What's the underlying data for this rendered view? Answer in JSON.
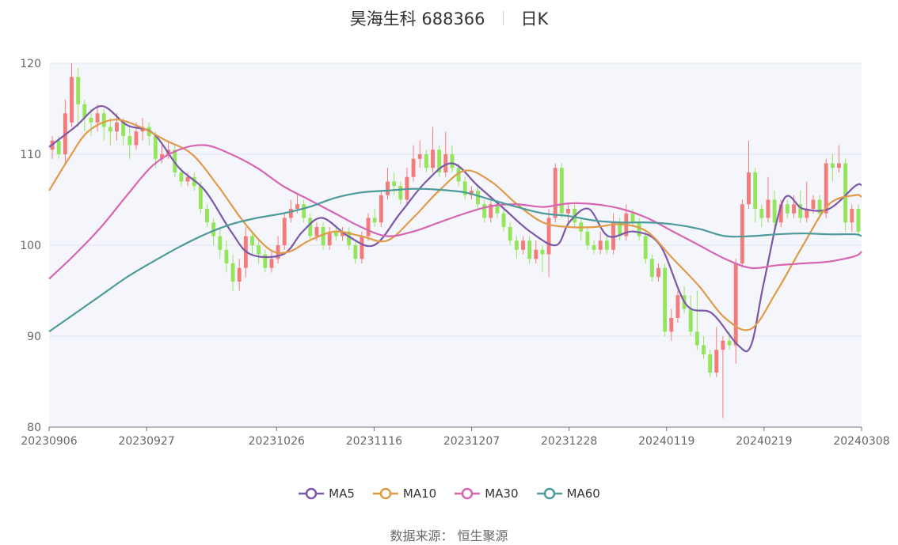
{
  "title": "昊海生科 688366",
  "subtitle": "日K",
  "source_label": "数据来源：",
  "source_value": "恒生聚源",
  "colors": {
    "up": "#f47b7b",
    "down": "#93e65b",
    "ma5": "#7b58a8",
    "ma10": "#e09b4a",
    "ma30": "#d865b0",
    "ma60": "#4d9a9a",
    "plot_bg": "#f5f6fb",
    "grid": "#dfe3f0"
  },
  "chart_data": {
    "type": "candlestick",
    "y_range": [
      80,
      120
    ],
    "y_ticks": [
      "120",
      "110",
      "100",
      "90",
      "80"
    ],
    "y_tick_values": [
      120,
      110,
      100,
      90,
      80
    ],
    "x_ticks": [
      "20230906",
      "20230927",
      "20231026",
      "20231116",
      "20231207",
      "20231228",
      "20240119",
      "20240219",
      "20240308"
    ],
    "x_tick_index": [
      0,
      15,
      35,
      50,
      65,
      80,
      95,
      110,
      125
    ],
    "n_days": 126,
    "candles": [
      [
        110.5,
        111.5,
        112.0,
        109.5
      ],
      [
        111.5,
        110.0,
        112.0,
        109.5
      ],
      [
        110.0,
        114.5,
        116.0,
        109.0
      ],
      [
        113.5,
        118.5,
        120.0,
        113.0
      ],
      [
        118.5,
        115.5,
        119.5,
        113.0
      ],
      [
        115.5,
        114.0,
        116.0,
        112.5
      ],
      [
        114.0,
        113.5,
        115.0,
        112.0
      ],
      [
        113.5,
        114.5,
        115.5,
        112.5
      ],
      [
        114.5,
        113.0,
        115.0,
        111.5
      ],
      [
        113.0,
        112.5,
        114.0,
        111.0
      ],
      [
        112.5,
        113.5,
        114.5,
        111.5
      ],
      [
        113.5,
        112.0,
        114.0,
        111.0
      ],
      [
        112.0,
        111.0,
        113.0,
        109.5
      ],
      [
        111.0,
        112.5,
        113.5,
        110.5
      ],
      [
        112.5,
        113.0,
        114.0,
        111.5
      ],
      [
        113.0,
        112.0,
        113.5,
        111.0
      ],
      [
        112.0,
        109.5,
        112.5,
        108.5
      ],
      [
        109.5,
        110.0,
        111.0,
        109.0
      ],
      [
        110.0,
        110.5,
        111.5,
        109.5
      ],
      [
        110.5,
        108.0,
        111.0,
        107.5
      ],
      [
        108.0,
        107.0,
        108.5,
        106.5
      ],
      [
        107.0,
        107.5,
        108.0,
        106.5
      ],
      [
        107.5,
        106.5,
        108.0,
        106.0
      ],
      [
        106.5,
        104.0,
        107.0,
        103.5
      ],
      [
        104.0,
        102.5,
        104.5,
        102.0
      ],
      [
        102.5,
        101.0,
        103.0,
        100.0
      ],
      [
        101.0,
        99.5,
        102.0,
        98.5
      ],
      [
        99.5,
        98.0,
        100.5,
        97.0
      ],
      [
        98.0,
        96.0,
        99.0,
        95.0
      ],
      [
        96.0,
        97.5,
        98.5,
        95.0
      ],
      [
        97.5,
        101.0,
        102.0,
        96.5
      ],
      [
        101.0,
        100.0,
        101.5,
        99.0
      ],
      [
        100.0,
        99.0,
        100.5,
        98.0
      ],
      [
        99.0,
        97.5,
        99.5,
        97.0
      ],
      [
        97.5,
        98.5,
        99.5,
        97.0
      ],
      [
        98.5,
        100.0,
        101.0,
        98.0
      ],
      [
        100.0,
        103.0,
        103.5,
        99.5
      ],
      [
        103.0,
        104.0,
        105.0,
        102.5
      ],
      [
        104.0,
        104.5,
        105.5,
        103.5
      ],
      [
        104.5,
        103.0,
        105.0,
        102.5
      ],
      [
        103.0,
        101.0,
        103.5,
        100.5
      ],
      [
        101.0,
        102.0,
        102.5,
        100.5
      ],
      [
        102.0,
        100.0,
        102.5,
        99.5
      ],
      [
        100.0,
        101.5,
        102.0,
        99.5
      ],
      [
        101.5,
        101.0,
        102.0,
        100.5
      ],
      [
        101.0,
        101.5,
        102.0,
        100.5
      ],
      [
        101.5,
        100.0,
        102.0,
        99.5
      ],
      [
        100.0,
        98.5,
        100.5,
        98.0
      ],
      [
        98.5,
        101.0,
        101.5,
        98.0
      ],
      [
        101.0,
        103.0,
        103.5,
        100.5
      ],
      [
        103.0,
        102.5,
        104.0,
        102.0
      ],
      [
        102.5,
        105.5,
        106.0,
        102.0
      ],
      [
        105.5,
        107.0,
        108.5,
        105.0
      ],
      [
        107.0,
        106.5,
        108.0,
        105.5
      ],
      [
        106.5,
        105.0,
        107.0,
        104.5
      ],
      [
        105.0,
        107.5,
        108.5,
        104.5
      ],
      [
        107.5,
        109.5,
        111.0,
        107.0
      ],
      [
        109.5,
        110.0,
        111.5,
        108.5
      ],
      [
        110.0,
        108.5,
        110.5,
        108.0
      ],
      [
        108.5,
        110.5,
        113.0,
        108.0
      ],
      [
        110.5,
        108.0,
        111.0,
        107.5
      ],
      [
        108.0,
        110.0,
        112.5,
        107.5
      ],
      [
        110.0,
        108.5,
        111.0,
        108.0
      ],
      [
        108.5,
        107.0,
        109.0,
        106.5
      ],
      [
        107.0,
        105.5,
        107.5,
        105.0
      ],
      [
        105.5,
        106.0,
        106.5,
        105.0
      ],
      [
        106.0,
        104.5,
        106.5,
        104.0
      ],
      [
        104.5,
        103.0,
        105.0,
        102.5
      ],
      [
        103.0,
        104.5,
        105.0,
        102.5
      ],
      [
        104.5,
        103.5,
        105.0,
        103.0
      ],
      [
        103.5,
        102.0,
        104.0,
        101.5
      ],
      [
        102.0,
        100.5,
        102.5,
        100.0
      ],
      [
        100.5,
        99.5,
        101.0,
        98.5
      ],
      [
        99.5,
        100.5,
        101.0,
        99.0
      ],
      [
        100.5,
        98.5,
        101.0,
        98.0
      ],
      [
        98.5,
        99.5,
        100.5,
        98.0
      ],
      [
        99.5,
        99.0,
        100.0,
        97.0
      ],
      [
        99.0,
        103.0,
        104.0,
        96.5
      ],
      [
        103.0,
        108.5,
        109.0,
        102.5
      ],
      [
        108.5,
        103.5,
        109.0,
        103.0
      ],
      [
        103.5,
        104.0,
        104.5,
        102.5
      ],
      [
        104.0,
        102.5,
        104.5,
        102.0
      ],
      [
        102.5,
        101.5,
        103.0,
        100.5
      ],
      [
        101.5,
        100.0,
        102.0,
        99.5
      ],
      [
        100.0,
        99.5,
        100.5,
        99.0
      ],
      [
        99.5,
        100.5,
        101.5,
        99.0
      ],
      [
        100.5,
        99.5,
        101.0,
        99.0
      ],
      [
        99.5,
        102.5,
        103.5,
        99.0
      ],
      [
        102.5,
        101.0,
        103.0,
        100.5
      ],
      [
        101.0,
        103.5,
        104.5,
        100.5
      ],
      [
        103.5,
        102.5,
        104.0,
        102.0
      ],
      [
        102.5,
        101.0,
        103.0,
        100.5
      ],
      [
        101.0,
        98.5,
        101.5,
        98.0
      ],
      [
        98.5,
        96.5,
        99.0,
        96.0
      ],
      [
        96.5,
        97.5,
        98.0,
        96.0
      ],
      [
        97.5,
        90.5,
        98.0,
        90.0
      ],
      [
        90.5,
        92.0,
        93.0,
        89.5
      ],
      [
        92.0,
        94.5,
        95.0,
        91.5
      ],
      [
        94.5,
        93.0,
        95.5,
        92.5
      ],
      [
        93.0,
        90.5,
        94.5,
        90.0
      ],
      [
        90.5,
        89.0,
        95.0,
        88.5
      ],
      [
        89.0,
        88.0,
        90.0,
        87.5
      ],
      [
        88.0,
        86.0,
        88.5,
        85.5
      ],
      [
        86.0,
        88.5,
        91.0,
        85.5
      ],
      [
        88.5,
        89.5,
        90.0,
        81.0
      ],
      [
        89.5,
        89.0,
        90.5,
        88.5
      ],
      [
        89.0,
        98.0,
        98.5,
        87.0
      ],
      [
        98.0,
        104.5,
        105.0,
        97.5
      ],
      [
        104.5,
        108.0,
        111.5,
        104.0
      ],
      [
        108.0,
        104.0,
        108.5,
        102.5
      ],
      [
        104.0,
        103.0,
        104.5,
        102.0
      ],
      [
        103.0,
        105.0,
        107.5,
        102.5
      ],
      [
        105.0,
        102.5,
        106.0,
        102.0
      ],
      [
        102.5,
        104.5,
        105.0,
        102.0
      ],
      [
        104.5,
        103.5,
        105.0,
        103.0
      ],
      [
        103.5,
        104.5,
        105.5,
        103.0
      ],
      [
        104.5,
        103.0,
        106.0,
        102.5
      ],
      [
        103.0,
        104.0,
        107.0,
        102.5
      ],
      [
        104.0,
        105.0,
        105.5,
        103.5
      ],
      [
        105.0,
        103.5,
        105.5,
        103.0
      ],
      [
        103.5,
        109.0,
        109.5,
        103.0
      ],
      [
        109.0,
        108.5,
        110.0,
        107.0
      ],
      [
        108.5,
        109.0,
        111.0,
        108.0
      ],
      [
        109.0,
        102.5,
        109.5,
        101.5
      ],
      [
        102.5,
        104.0,
        104.5,
        101.5
      ],
      [
        104.0,
        101.5,
        104.5,
        101.0
      ]
    ],
    "series": [
      {
        "name": "MA5",
        "color_key": "ma5",
        "points": [
          [
            0,
            110.8
          ],
          [
            4,
            113.0
          ],
          [
            8,
            115.3
          ],
          [
            12,
            113.2
          ],
          [
            16,
            112.3
          ],
          [
            20,
            108.5
          ],
          [
            24,
            106.0
          ],
          [
            28,
            101.5
          ],
          [
            31,
            99.0
          ],
          [
            36,
            99.0
          ],
          [
            39,
            101.5
          ],
          [
            42,
            103.0
          ],
          [
            46,
            101.0
          ],
          [
            50,
            100.0
          ],
          [
            54,
            103.5
          ],
          [
            58,
            107.0
          ],
          [
            62,
            109.0
          ],
          [
            66,
            106.5
          ],
          [
            70,
            104.0
          ],
          [
            74,
            101.5
          ],
          [
            78,
            100.0
          ],
          [
            80,
            102.5
          ],
          [
            83,
            104.0
          ],
          [
            86,
            101.0
          ],
          [
            90,
            101.5
          ],
          [
            94,
            100.0
          ],
          [
            98,
            93.5
          ],
          [
            102,
            92.5
          ],
          [
            106,
            89.0
          ],
          [
            108,
            89.0
          ],
          [
            110,
            96.0
          ],
          [
            113,
            105.0
          ],
          [
            116,
            104.0
          ],
          [
            120,
            104.0
          ],
          [
            124,
            106.5
          ],
          [
            127,
            106.6
          ]
        ]
      },
      {
        "name": "MA10",
        "color_key": "ma10",
        "points": [
          [
            0,
            106.0
          ],
          [
            3,
            109.5
          ],
          [
            6,
            112.5
          ],
          [
            10,
            113.8
          ],
          [
            14,
            113.0
          ],
          [
            18,
            111.5
          ],
          [
            22,
            110.0
          ],
          [
            26,
            106.5
          ],
          [
            30,
            102.5
          ],
          [
            34,
            99.5
          ],
          [
            37,
            99.3
          ],
          [
            40,
            100.5
          ],
          [
            44,
            101.5
          ],
          [
            48,
            101.0
          ],
          [
            52,
            100.5
          ],
          [
            56,
            103.0
          ],
          [
            60,
            106.0
          ],
          [
            64,
            108.2
          ],
          [
            68,
            107.0
          ],
          [
            72,
            104.5
          ],
          [
            76,
            102.5
          ],
          [
            80,
            102.0
          ],
          [
            84,
            102.0
          ],
          [
            88,
            102.3
          ],
          [
            92,
            101.5
          ],
          [
            96,
            98.5
          ],
          [
            100,
            95.5
          ],
          [
            104,
            92.0
          ],
          [
            108,
            90.8
          ],
          [
            112,
            95.0
          ],
          [
            116,
            100.0
          ],
          [
            120,
            104.5
          ],
          [
            124,
            105.5
          ],
          [
            127,
            105.3
          ]
        ]
      },
      {
        "name": "MA30",
        "color_key": "ma30",
        "points": [
          [
            0,
            96.3
          ],
          [
            4,
            99.0
          ],
          [
            8,
            102.0
          ],
          [
            12,
            105.5
          ],
          [
            16,
            108.8
          ],
          [
            20,
            110.5
          ],
          [
            24,
            111.0
          ],
          [
            28,
            110.0
          ],
          [
            32,
            108.5
          ],
          [
            36,
            106.5
          ],
          [
            40,
            105.0
          ],
          [
            44,
            103.5
          ],
          [
            48,
            102.0
          ],
          [
            52,
            101.0
          ],
          [
            56,
            101.5
          ],
          [
            60,
            102.5
          ],
          [
            64,
            103.5
          ],
          [
            68,
            104.3
          ],
          [
            72,
            104.5
          ],
          [
            76,
            104.2
          ],
          [
            80,
            104.6
          ],
          [
            84,
            104.5
          ],
          [
            88,
            104.0
          ],
          [
            92,
            103.0
          ],
          [
            96,
            101.5
          ],
          [
            100,
            100.0
          ],
          [
            104,
            98.5
          ],
          [
            108,
            97.5
          ],
          [
            112,
            97.8
          ],
          [
            116,
            98.0
          ],
          [
            120,
            98.2
          ],
          [
            124,
            98.8
          ],
          [
            127,
            99.3
          ]
        ]
      },
      {
        "name": "MA60",
        "color_key": "ma60",
        "points": [
          [
            0,
            90.5
          ],
          [
            4,
            92.5
          ],
          [
            8,
            94.5
          ],
          [
            12,
            96.5
          ],
          [
            16,
            98.2
          ],
          [
            20,
            99.8
          ],
          [
            24,
            101.2
          ],
          [
            28,
            102.3
          ],
          [
            32,
            103.0
          ],
          [
            36,
            103.5
          ],
          [
            40,
            104.2
          ],
          [
            44,
            105.2
          ],
          [
            48,
            105.8
          ],
          [
            52,
            106.0
          ],
          [
            56,
            106.2
          ],
          [
            60,
            106.1
          ],
          [
            64,
            105.8
          ],
          [
            68,
            105.0
          ],
          [
            72,
            104.2
          ],
          [
            76,
            103.5
          ],
          [
            80,
            103.2
          ],
          [
            84,
            102.7
          ],
          [
            88,
            102.5
          ],
          [
            92,
            102.5
          ],
          [
            96,
            102.3
          ],
          [
            100,
            101.8
          ],
          [
            104,
            101.0
          ],
          [
            108,
            101.0
          ],
          [
            112,
            101.2
          ],
          [
            116,
            101.3
          ],
          [
            120,
            101.2
          ],
          [
            124,
            101.2
          ],
          [
            127,
            101.0
          ]
        ]
      }
    ]
  }
}
